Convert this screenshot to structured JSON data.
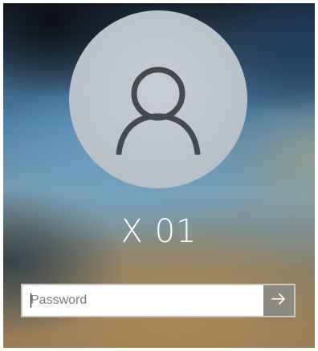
{
  "user": {
    "name": "X 01",
    "avatar_icon": "user-silhouette-icon"
  },
  "password": {
    "placeholder": "Password",
    "value": ""
  },
  "submit": {
    "icon": "arrow-right-icon"
  },
  "colors": {
    "avatar_bg": "#b8c1c9",
    "avatar_icon": "#454a4f",
    "submit_bg": "#8e8a82",
    "text": "#ffffff"
  }
}
